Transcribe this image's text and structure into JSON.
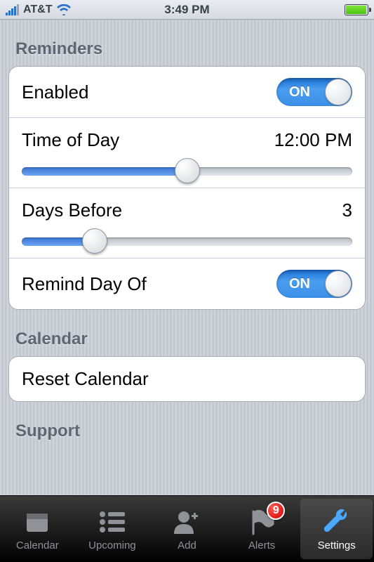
{
  "status": {
    "carrier": "AT&T",
    "time": "3:49 PM"
  },
  "sections": {
    "reminders": {
      "title": "Reminders",
      "enabled": {
        "label": "Enabled",
        "on_text": "ON"
      },
      "time_of_day": {
        "label": "Time of Day",
        "value": "12:00 PM",
        "percent": 50
      },
      "days_before": {
        "label": "Days Before",
        "value": "3",
        "percent": 22
      },
      "remind_day_of": {
        "label": "Remind Day Of",
        "on_text": "ON"
      }
    },
    "calendar": {
      "title": "Calendar",
      "reset": {
        "label": "Reset Calendar"
      }
    },
    "support": {
      "title": "Support"
    }
  },
  "tabs": {
    "calendar": "Calendar",
    "upcoming": "Upcoming",
    "add": "Add",
    "alerts": "Alerts",
    "alerts_badge": "9",
    "settings": "Settings"
  }
}
